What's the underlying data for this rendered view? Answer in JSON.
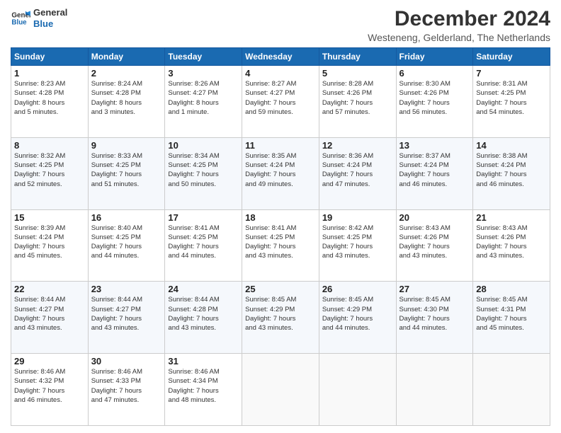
{
  "logo": {
    "line1": "General",
    "line2": "Blue"
  },
  "header": {
    "title": "December 2024",
    "subtitle": "Westeneng, Gelderland, The Netherlands"
  },
  "days_of_week": [
    "Sunday",
    "Monday",
    "Tuesday",
    "Wednesday",
    "Thursday",
    "Friday",
    "Saturday"
  ],
  "weeks": [
    [
      {
        "day": "1",
        "info": "Sunrise: 8:23 AM\nSunset: 4:28 PM\nDaylight: 8 hours\nand 5 minutes."
      },
      {
        "day": "2",
        "info": "Sunrise: 8:24 AM\nSunset: 4:28 PM\nDaylight: 8 hours\nand 3 minutes."
      },
      {
        "day": "3",
        "info": "Sunrise: 8:26 AM\nSunset: 4:27 PM\nDaylight: 8 hours\nand 1 minute."
      },
      {
        "day": "4",
        "info": "Sunrise: 8:27 AM\nSunset: 4:27 PM\nDaylight: 7 hours\nand 59 minutes."
      },
      {
        "day": "5",
        "info": "Sunrise: 8:28 AM\nSunset: 4:26 PM\nDaylight: 7 hours\nand 57 minutes."
      },
      {
        "day": "6",
        "info": "Sunrise: 8:30 AM\nSunset: 4:26 PM\nDaylight: 7 hours\nand 56 minutes."
      },
      {
        "day": "7",
        "info": "Sunrise: 8:31 AM\nSunset: 4:25 PM\nDaylight: 7 hours\nand 54 minutes."
      }
    ],
    [
      {
        "day": "8",
        "info": "Sunrise: 8:32 AM\nSunset: 4:25 PM\nDaylight: 7 hours\nand 52 minutes."
      },
      {
        "day": "9",
        "info": "Sunrise: 8:33 AM\nSunset: 4:25 PM\nDaylight: 7 hours\nand 51 minutes."
      },
      {
        "day": "10",
        "info": "Sunrise: 8:34 AM\nSunset: 4:25 PM\nDaylight: 7 hours\nand 50 minutes."
      },
      {
        "day": "11",
        "info": "Sunrise: 8:35 AM\nSunset: 4:24 PM\nDaylight: 7 hours\nand 49 minutes."
      },
      {
        "day": "12",
        "info": "Sunrise: 8:36 AM\nSunset: 4:24 PM\nDaylight: 7 hours\nand 47 minutes."
      },
      {
        "day": "13",
        "info": "Sunrise: 8:37 AM\nSunset: 4:24 PM\nDaylight: 7 hours\nand 46 minutes."
      },
      {
        "day": "14",
        "info": "Sunrise: 8:38 AM\nSunset: 4:24 PM\nDaylight: 7 hours\nand 46 minutes."
      }
    ],
    [
      {
        "day": "15",
        "info": "Sunrise: 8:39 AM\nSunset: 4:24 PM\nDaylight: 7 hours\nand 45 minutes."
      },
      {
        "day": "16",
        "info": "Sunrise: 8:40 AM\nSunset: 4:25 PM\nDaylight: 7 hours\nand 44 minutes."
      },
      {
        "day": "17",
        "info": "Sunrise: 8:41 AM\nSunset: 4:25 PM\nDaylight: 7 hours\nand 44 minutes."
      },
      {
        "day": "18",
        "info": "Sunrise: 8:41 AM\nSunset: 4:25 PM\nDaylight: 7 hours\nand 43 minutes."
      },
      {
        "day": "19",
        "info": "Sunrise: 8:42 AM\nSunset: 4:25 PM\nDaylight: 7 hours\nand 43 minutes."
      },
      {
        "day": "20",
        "info": "Sunrise: 8:43 AM\nSunset: 4:26 PM\nDaylight: 7 hours\nand 43 minutes."
      },
      {
        "day": "21",
        "info": "Sunrise: 8:43 AM\nSunset: 4:26 PM\nDaylight: 7 hours\nand 43 minutes."
      }
    ],
    [
      {
        "day": "22",
        "info": "Sunrise: 8:44 AM\nSunset: 4:27 PM\nDaylight: 7 hours\nand 43 minutes."
      },
      {
        "day": "23",
        "info": "Sunrise: 8:44 AM\nSunset: 4:27 PM\nDaylight: 7 hours\nand 43 minutes."
      },
      {
        "day": "24",
        "info": "Sunrise: 8:44 AM\nSunset: 4:28 PM\nDaylight: 7 hours\nand 43 minutes."
      },
      {
        "day": "25",
        "info": "Sunrise: 8:45 AM\nSunset: 4:29 PM\nDaylight: 7 hours\nand 43 minutes."
      },
      {
        "day": "26",
        "info": "Sunrise: 8:45 AM\nSunset: 4:29 PM\nDaylight: 7 hours\nand 44 minutes."
      },
      {
        "day": "27",
        "info": "Sunrise: 8:45 AM\nSunset: 4:30 PM\nDaylight: 7 hours\nand 44 minutes."
      },
      {
        "day": "28",
        "info": "Sunrise: 8:45 AM\nSunset: 4:31 PM\nDaylight: 7 hours\nand 45 minutes."
      }
    ],
    [
      {
        "day": "29",
        "info": "Sunrise: 8:46 AM\nSunset: 4:32 PM\nDaylight: 7 hours\nand 46 minutes."
      },
      {
        "day": "30",
        "info": "Sunrise: 8:46 AM\nSunset: 4:33 PM\nDaylight: 7 hours\nand 47 minutes."
      },
      {
        "day": "31",
        "info": "Sunrise: 8:46 AM\nSunset: 4:34 PM\nDaylight: 7 hours\nand 48 minutes."
      },
      null,
      null,
      null,
      null
    ]
  ]
}
